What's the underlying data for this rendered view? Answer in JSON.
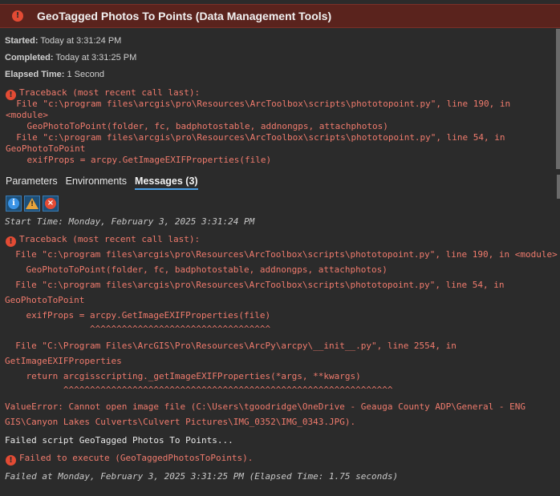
{
  "header": {
    "title": "GeoTagged Photos To Points (Data Management Tools)",
    "icon": "error-icon",
    "background": "#5a231d"
  },
  "summary": {
    "started_label": "Started:",
    "started_value": "Today at 3:31:24 PM",
    "completed_label": "Completed:",
    "completed_value": "Today at 3:31:25 PM",
    "elapsed_label": "Elapsed Time:",
    "elapsed_value": "1 Second"
  },
  "top_traceback": [
    "Traceback (most recent call last):",
    "  File \"c:\\program files\\arcgis\\pro\\Resources\\ArcToolbox\\scripts\\phototopoint.py\", line 190, in",
    "<module>",
    "    GeoPhotoToPoint(folder, fc, badphotostable, addnongps, attachphotos)",
    "  File \"c:\\program files\\arcgis\\pro\\Resources\\ArcToolbox\\scripts\\phototopoint.py\", line 54, in",
    "GeoPhotoToPoint",
    "    exifProps = arcpy.GetImageEXIFProperties(file)"
  ],
  "tabs": [
    {
      "label": "Parameters",
      "active": false
    },
    {
      "label": "Environments",
      "active": false
    },
    {
      "label": "Messages (3)",
      "active": true
    }
  ],
  "filters": [
    {
      "name": "info-icon",
      "glyph": "i"
    },
    {
      "name": "warning-icon",
      "glyph": "!"
    },
    {
      "name": "error-icon",
      "glyph": "×"
    }
  ],
  "messages": {
    "start_time": "Start Time: Monday, February 3, 2025 3:31:24 PM",
    "traceback": [
      "Traceback (most recent call last):",
      "  File \"c:\\program files\\arcgis\\pro\\Resources\\ArcToolbox\\scripts\\phototopoint.py\", line 190, in <module>",
      "    GeoPhotoToPoint(folder, fc, badphotostable, addnongps, attachphotos)",
      "  File \"c:\\program files\\arcgis\\pro\\Resources\\ArcToolbox\\scripts\\phototopoint.py\", line 54, in",
      "GeoPhotoToPoint",
      "    exifProps = arcpy.GetImageEXIFProperties(file)",
      "                ^^^^^^^^^^^^^^^^^^^^^^^^^^^^^^^^^^",
      "  File \"C:\\Program Files\\ArcGIS\\Pro\\Resources\\ArcPy\\arcpy\\__init__.py\", line 2554, in",
      "GetImageEXIFProperties",
      "    return arcgisscripting._getImageEXIFProperties(*args, **kwargs)",
      "           ^^^^^^^^^^^^^^^^^^^^^^^^^^^^^^^^^^^^^^^^^^^^^^^^^^^^^^^^^^^^^^",
      "ValueError: Cannot open image file (C:\\Users\\tgoodridge\\OneDrive - Geauga County ADP\\General - ENG",
      "GIS\\Canyon Lakes Culverts\\Culvert Pictures\\IMG_0352\\IMG_0343.JPG)."
    ],
    "failed_script": "Failed script GeoTagged Photos To Points...",
    "failed_execute": "Failed to execute (GeoTaggedPhotosToPoints).",
    "failed_at": "Failed at Monday, February 3, 2025 3:31:25 PM (Elapsed Time: 1.75 seconds)"
  }
}
